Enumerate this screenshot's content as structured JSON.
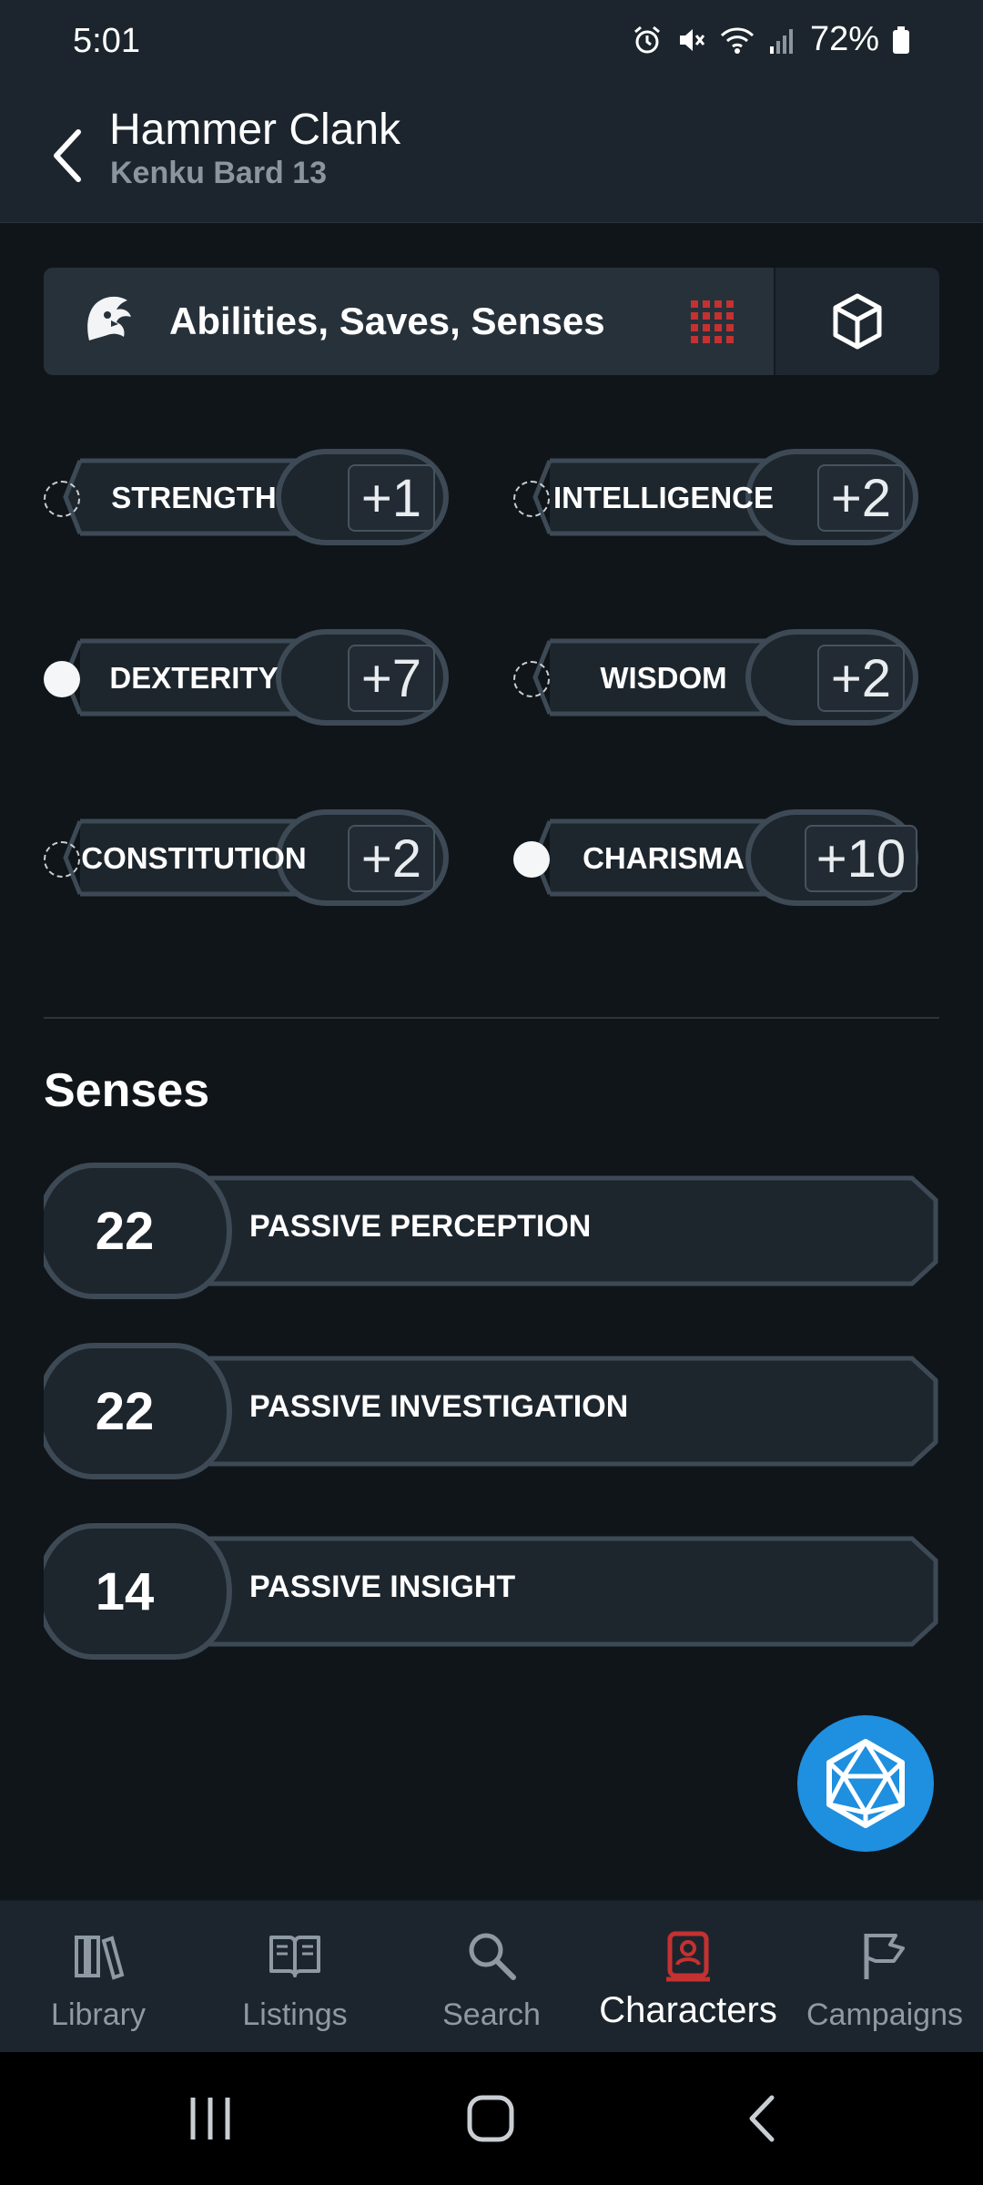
{
  "status_bar": {
    "time": "5:01",
    "battery": "72%"
  },
  "header": {
    "title": "Hammer Clank",
    "subtitle": "Kenku Bard 13"
  },
  "section_selector": {
    "label": "Abilities, Saves, Senses"
  },
  "saving_throws": [
    {
      "name": "STRENGTH",
      "modifier": "+1",
      "proficient": false
    },
    {
      "name": "INTELLIGENCE",
      "modifier": "+2",
      "proficient": false
    },
    {
      "name": "DEXTERITY",
      "modifier": "+7",
      "proficient": true
    },
    {
      "name": "WISDOM",
      "modifier": "+2",
      "proficient": false
    },
    {
      "name": "CONSTITUTION",
      "modifier": "+2",
      "proficient": false
    },
    {
      "name": "CHARISMA",
      "modifier": "+10",
      "proficient": true
    }
  ],
  "saving_throw_labels": {
    "constitution_line1": "CONSTITUTIO",
    "constitution_line2": "N"
  },
  "senses": {
    "title": "Senses",
    "items": [
      {
        "value": "22",
        "label": "PASSIVE PERCEPTION"
      },
      {
        "value": "22",
        "label": "PASSIVE INVESTIGATION"
      },
      {
        "value": "14",
        "label": "PASSIVE INSIGHT"
      }
    ]
  },
  "bottom_nav": [
    {
      "label": "Library",
      "icon": "library-icon",
      "active": false
    },
    {
      "label": "Listings",
      "icon": "book-icon",
      "active": false
    },
    {
      "label": "Search",
      "icon": "search-icon",
      "active": false
    },
    {
      "label": "Characters",
      "icon": "character-icon",
      "active": true
    },
    {
      "label": "Campaigns",
      "icon": "flag-icon",
      "active": false
    }
  ],
  "colors": {
    "accent_red": "#c53131",
    "fab_blue": "#1f8fe0",
    "panel": "#222b33",
    "border": "#46535f"
  }
}
